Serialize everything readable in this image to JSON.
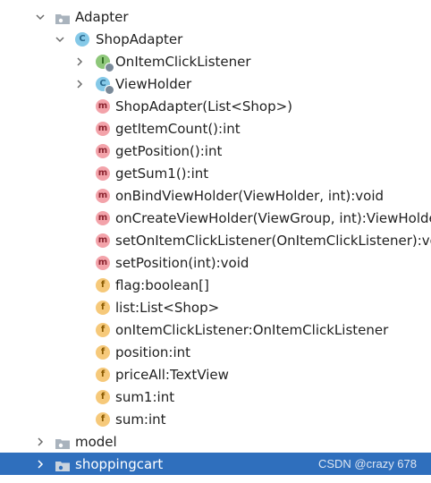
{
  "tree": {
    "adapter_package": {
      "label": "Adapter",
      "icon": "folder-icon"
    },
    "shop_adapter_class": {
      "label": "ShopAdapter",
      "icon": "class-icon"
    },
    "members": [
      {
        "label": "OnItemClickListener",
        "kind": "interface",
        "icon": "I",
        "expandable": true
      },
      {
        "label": "ViewHolder",
        "kind": "class",
        "icon": "C",
        "expandable": true
      },
      {
        "label": "ShopAdapter(List<Shop>)",
        "kind": "method",
        "icon": "m"
      },
      {
        "label": "getItemCount():int",
        "kind": "method",
        "icon": "m"
      },
      {
        "label": "getPosition():int",
        "kind": "method",
        "icon": "m"
      },
      {
        "label": "getSum1():int",
        "kind": "method",
        "icon": "m"
      },
      {
        "label": "onBindViewHolder(ViewHolder, int):void",
        "kind": "method",
        "icon": "m"
      },
      {
        "label": "onCreateViewHolder(ViewGroup, int):ViewHolder",
        "kind": "method",
        "icon": "m"
      },
      {
        "label": "setOnItemClickListener(OnItemClickListener):void",
        "kind": "method",
        "icon": "m"
      },
      {
        "label": "setPosition(int):void",
        "kind": "method",
        "icon": "m"
      },
      {
        "label": "flag:boolean[]",
        "kind": "field",
        "icon": "f"
      },
      {
        "label": "list:List<Shop>",
        "kind": "field",
        "icon": "f"
      },
      {
        "label": "onItemClickListener:OnItemClickListener",
        "kind": "field",
        "icon": "f"
      },
      {
        "label": "position:int",
        "kind": "field",
        "icon": "f"
      },
      {
        "label": "priceAll:TextView",
        "kind": "field",
        "icon": "f"
      },
      {
        "label": "sum1:int",
        "kind": "field",
        "icon": "f"
      },
      {
        "label": "sum:int",
        "kind": "field",
        "icon": "f"
      }
    ],
    "model_package": {
      "label": "model",
      "icon": "folder-icon"
    },
    "shoppingcart_package": {
      "label": "shoppingcart",
      "icon": "folder-icon",
      "selected": true
    }
  },
  "watermark": "CSDN @crazy 678",
  "colors": {
    "selection": "#2f6fbd",
    "class_icon": "#85c9e8",
    "interface_icon": "#8ec77a",
    "method_icon": "#f3a3aa",
    "field_icon": "#f6c97a"
  }
}
